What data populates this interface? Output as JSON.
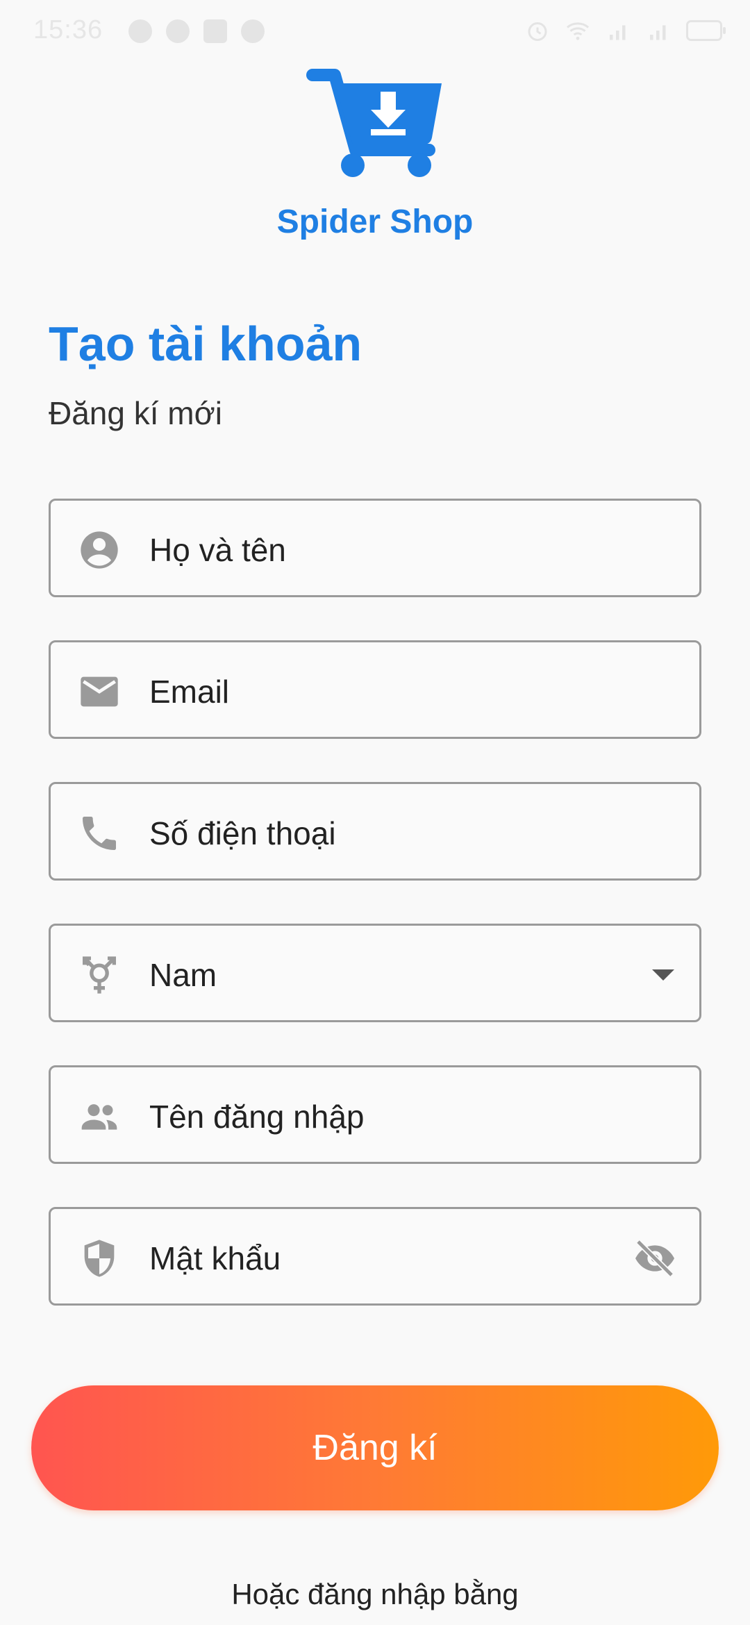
{
  "status_bar": {
    "time": "15:36"
  },
  "brand": {
    "name": "Spider Shop",
    "color": "#1f7fe3"
  },
  "header": {
    "title": "Tạo tài khoản",
    "subtitle": "Đăng kí mới"
  },
  "form": {
    "full_name": {
      "placeholder": "Họ và tên",
      "icon": "account-circle-icon"
    },
    "email": {
      "placeholder": "Email",
      "icon": "mail-icon"
    },
    "phone": {
      "placeholder": "Số điện thoại",
      "icon": "phone-icon"
    },
    "gender": {
      "value": "Nam",
      "icon": "transgender-icon"
    },
    "username": {
      "placeholder": "Tên đăng nhập",
      "icon": "people-icon"
    },
    "password": {
      "placeholder": "Mật khẩu",
      "icon": "shield-icon",
      "toggle_icon": "eye-off-icon"
    }
  },
  "actions": {
    "register_label": "Đăng kí",
    "alt_login_label": "Hoặc đăng nhập bằng",
    "gradient": [
      "#ff5550",
      "#ff9a08"
    ]
  }
}
